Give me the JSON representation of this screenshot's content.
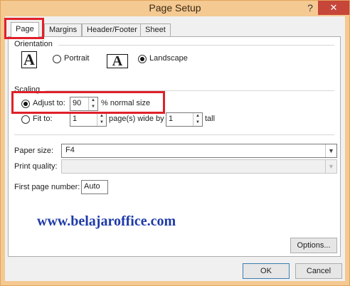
{
  "window": {
    "title": "Page Setup",
    "help_glyph": "?",
    "close_glyph": "✕"
  },
  "tabs": [
    {
      "label": "Page",
      "active": true
    },
    {
      "label": "Margins",
      "active": false
    },
    {
      "label": "Header/Footer",
      "active": false
    },
    {
      "label": "Sheet",
      "active": false
    }
  ],
  "orientation": {
    "heading": "Orientation",
    "portrait_label": "Portrait",
    "landscape_label": "Landscape",
    "icon_letter": "A",
    "selected": "landscape"
  },
  "scaling": {
    "heading": "Scaling",
    "adjust_label": "Adjust to:",
    "adjust_value": "90",
    "adjust_suffix": "% normal size",
    "fit_label": "Fit to:",
    "fit_wide_value": "1",
    "wide_by_label": "page(s) wide by",
    "fit_tall_value": "1",
    "tall_label": "tall",
    "selected": "adjust"
  },
  "paper_size": {
    "label": "Paper size:",
    "value": "F4"
  },
  "print_quality": {
    "label": "Print quality:",
    "value": ""
  },
  "first_page": {
    "label": "First page number:",
    "value": "Auto"
  },
  "watermark": "www.belajaroffice.com",
  "buttons": {
    "options": "Options...",
    "ok": "OK",
    "cancel": "Cancel"
  },
  "colors": {
    "highlight": "#e0202a",
    "title_bar": "#f4c992",
    "close": "#c7463a"
  }
}
